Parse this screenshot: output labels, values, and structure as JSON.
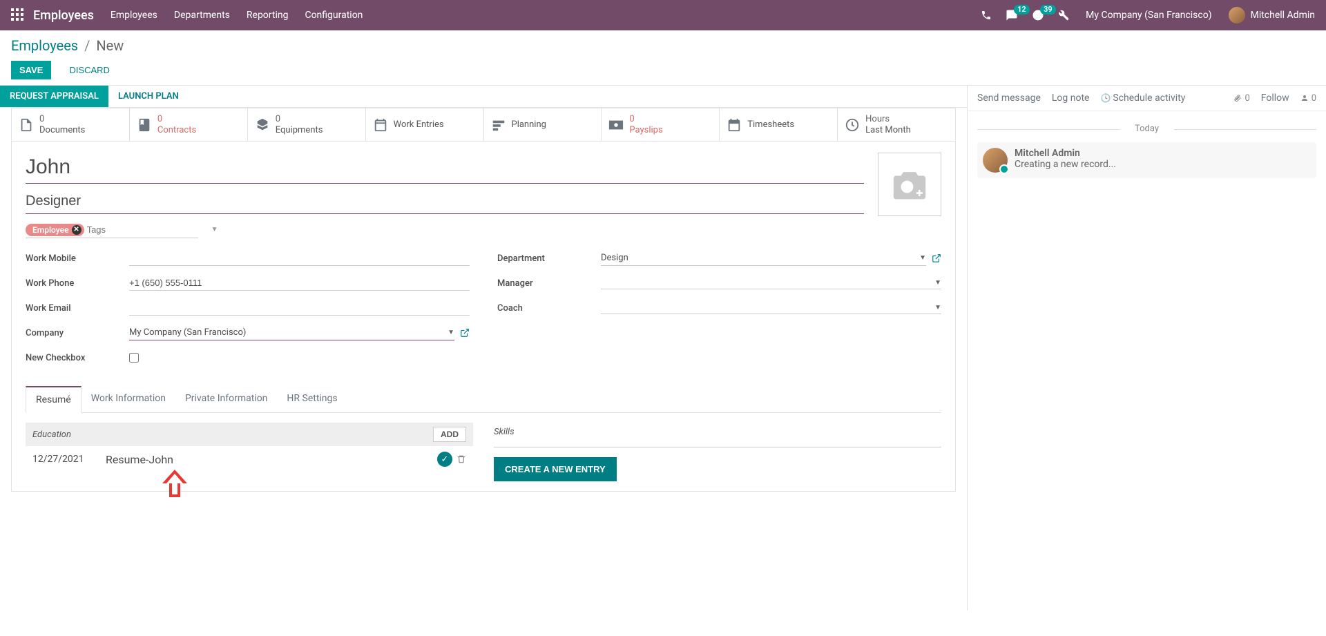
{
  "nav": {
    "app": "Employees",
    "links": [
      "Employees",
      "Departments",
      "Reporting",
      "Configuration"
    ],
    "chat_badge": "12",
    "activity_badge": "39",
    "company": "My Company (San Francisco)",
    "user": "Mitchell Admin"
  },
  "breadcrumb": {
    "root": "Employees",
    "leaf": "New"
  },
  "buttons": {
    "save": "SAVE",
    "discard": "DISCARD"
  },
  "statusbar": {
    "request": "REQUEST APPRAISAL",
    "launch": "LAUNCH PLAN"
  },
  "stats": [
    {
      "value": "0",
      "label": "Documents",
      "alert": false
    },
    {
      "value": "0",
      "label": "Contracts",
      "alert": true
    },
    {
      "value": "0",
      "label": "Equipments",
      "alert": false
    },
    {
      "value": "",
      "label": "Work Entries",
      "alert": false
    },
    {
      "value": "",
      "label": "Planning",
      "alert": false
    },
    {
      "value": "0",
      "label": "Payslips",
      "alert": true
    },
    {
      "value": "",
      "label": "Timesheets",
      "alert": false
    },
    {
      "value": "Hours",
      "label": "Last Month",
      "alert": false
    }
  ],
  "title": {
    "name": "John",
    "job": "Designer"
  },
  "tags": {
    "pill": "Employee",
    "placeholder": "Tags"
  },
  "fields_left": {
    "work_mobile_label": "Work Mobile",
    "work_mobile_value": "",
    "work_phone_label": "Work Phone",
    "work_phone_value": "+1 (650) 555-0111",
    "work_email_label": "Work Email",
    "work_email_value": "",
    "company_label": "Company",
    "company_value": "My Company (San Francisco)",
    "new_checkbox_label": "New Checkbox"
  },
  "fields_right": {
    "department_label": "Department",
    "department_value": "Design",
    "manager_label": "Manager",
    "manager_value": "",
    "coach_label": "Coach",
    "coach_value": ""
  },
  "tabs": [
    "Resumé",
    "Work Information",
    "Private Information",
    "HR Settings"
  ],
  "resume": {
    "section": "Education",
    "add": "ADD",
    "entry_date": "12/27/2021",
    "entry_title": "Resume-John"
  },
  "skills": {
    "title": "Skills",
    "create": "CREATE A NEW ENTRY"
  },
  "chatter": {
    "send": "Send message",
    "log": "Log note",
    "schedule": "Schedule activity",
    "attach_count": "0",
    "follow": "Follow",
    "followers": "0",
    "today": "Today",
    "msg_from": "Mitchell Admin",
    "msg_text": "Creating a new record..."
  }
}
